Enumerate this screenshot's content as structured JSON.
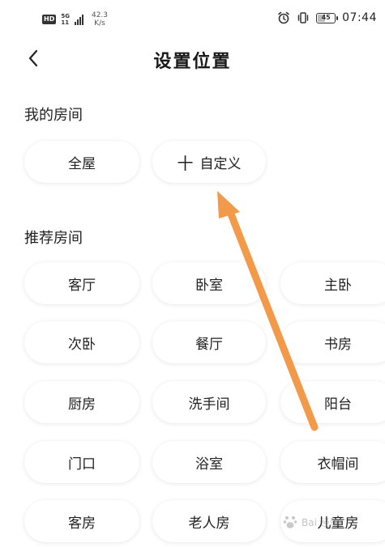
{
  "status_bar": {
    "hd": "HD",
    "net_type": "5G",
    "net_sub": "11",
    "speed_value": "42.3",
    "speed_unit": "K/s",
    "battery": "45",
    "battery_fill": 0.45,
    "time": "07:44",
    "icons": [
      "alarm-icon",
      "vibrate-icon",
      "battery-icon"
    ]
  },
  "header": {
    "back_icon": "chevron-left-icon",
    "title": "设置位置"
  },
  "my_rooms": {
    "title": "我的房间",
    "items": [
      {
        "label": "全屋"
      },
      {
        "label": "自定义",
        "icon": "plus-icon",
        "icon_glyph": "十"
      }
    ]
  },
  "recommended_rooms": {
    "title": "推荐房间",
    "items": [
      {
        "label": "客厅"
      },
      {
        "label": "卧室"
      },
      {
        "label": "主卧"
      },
      {
        "label": "次卧"
      },
      {
        "label": "餐厅"
      },
      {
        "label": "书房"
      },
      {
        "label": "厨房"
      },
      {
        "label": "洗手间"
      },
      {
        "label": "阳台"
      },
      {
        "label": "门口"
      },
      {
        "label": "浴室"
      },
      {
        "label": "衣帽间"
      },
      {
        "label": "客房"
      },
      {
        "label": "老人房"
      },
      {
        "label": "儿童房"
      }
    ]
  },
  "annotation": {
    "color": "#f39a4a"
  },
  "watermark": {
    "text": "Bai 经验"
  }
}
